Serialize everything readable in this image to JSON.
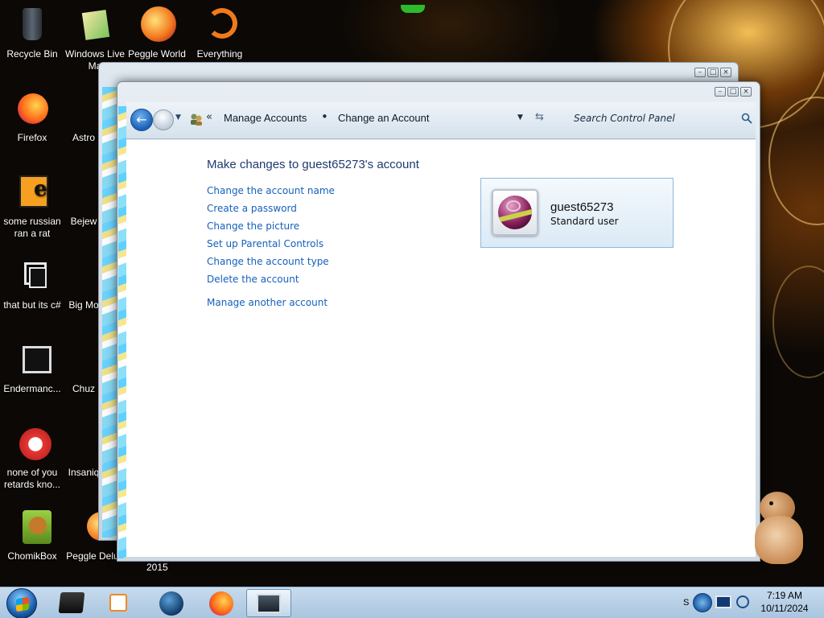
{
  "desktop": {
    "icons": [
      {
        "label": "Recycle Bin"
      },
      {
        "label": "Windows Live Ma"
      },
      {
        "label": "Peggle World"
      },
      {
        "label": "Everything"
      },
      {
        "label": "Firefox"
      },
      {
        "label": "Astro Delu"
      },
      {
        "label": "some russian ran a rat"
      },
      {
        "label": "Bejew Delu"
      },
      {
        "label": "that but its c#"
      },
      {
        "label": "Big Mo Delu"
      },
      {
        "label": "Endermanc..."
      },
      {
        "label": "Chuz Delu"
      },
      {
        "label": "none of you retards kno..."
      },
      {
        "label": "Insaniq Delu"
      },
      {
        "label": "ChomikBox"
      },
      {
        "label": "Peggle Delux"
      }
    ],
    "stray_label": "2015"
  },
  "window": {
    "nav": {
      "back_icon": "back-arrow-icon",
      "forward_icon": "forward-arrow-icon"
    },
    "breadcrumb": {
      "overflow": "«",
      "items": [
        "Manage Accounts",
        "Change an Account"
      ],
      "separator": "•"
    },
    "search": {
      "placeholder": "Search Control Panel"
    },
    "heading": "Make changes to guest65273's account",
    "tasks": [
      "Change the account name",
      "Create a password",
      "Change the picture",
      "Set up Parental Controls",
      "Change the account type",
      "Delete the account"
    ],
    "other_task": "Manage another account",
    "account": {
      "name": "guest65273",
      "type": "Standard user"
    }
  },
  "taskbar": {
    "tray_overflow": "S",
    "clock": {
      "time": "7:19 AM",
      "date": "10/11/2024"
    }
  }
}
